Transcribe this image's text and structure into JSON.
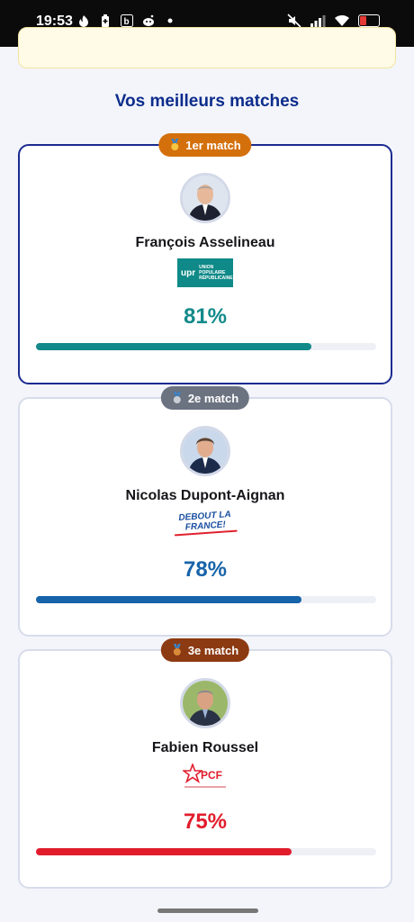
{
  "status": {
    "time": "19:53"
  },
  "section_title": "Vos meilleurs matches",
  "matches": [
    {
      "badge": "1er match",
      "badge_color": "#d4700c",
      "name": "François Asselineau",
      "party": "upr",
      "party_logo_text": "UNION POPULAIRE RÉPUBLICAINE",
      "percent_label": "81%",
      "percent": 81,
      "color": "#138a8a"
    },
    {
      "badge": "2e match",
      "badge_color": "#6b7280",
      "name": "Nicolas Dupont-Aignan",
      "party": "DEBOUT LA FRANCE!",
      "percent_label": "78%",
      "percent": 78,
      "color": "#1763aa"
    },
    {
      "badge": "3e match",
      "badge_color": "#8c3a12",
      "name": "Fabien Roussel",
      "party": "PCF",
      "percent_label": "75%",
      "percent": 75,
      "color": "#e11d2d"
    }
  ]
}
